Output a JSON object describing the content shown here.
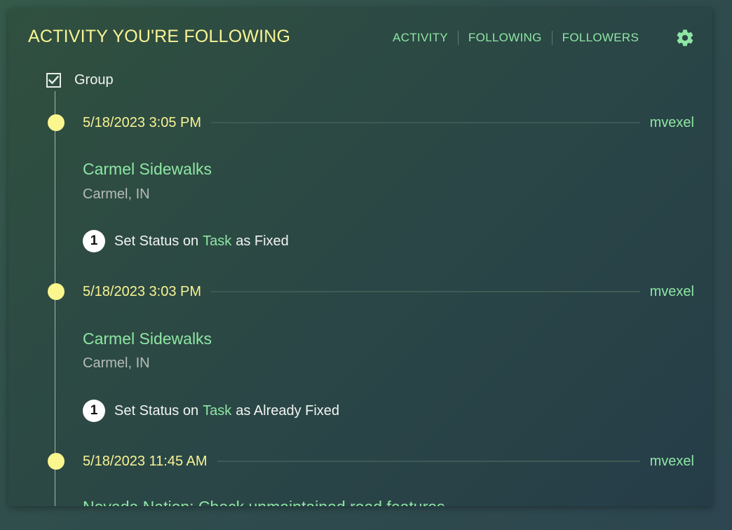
{
  "header": {
    "title": "ACTIVITY YOU'RE FOLLOWING",
    "nav": [
      {
        "label": "ACTIVITY"
      },
      {
        "label": "FOLLOWING"
      },
      {
        "label": "FOLLOWERS"
      }
    ],
    "settings_icon": "gear-icon"
  },
  "group_toggle": {
    "label": "Group",
    "checked": true
  },
  "entries": [
    {
      "timestamp": "5/18/2023 3:05 PM",
      "user": "mvexel",
      "challenge": "Carmel Sidewalks",
      "location": "Carmel, IN",
      "count": "1",
      "action_prefix": "Set Status on",
      "action_link": "Task",
      "action_suffix": "as Fixed"
    },
    {
      "timestamp": "5/18/2023 3:03 PM",
      "user": "mvexel",
      "challenge": "Carmel Sidewalks",
      "location": "Carmel, IN",
      "count": "1",
      "action_prefix": "Set Status on",
      "action_link": "Task",
      "action_suffix": "as Already Fixed"
    },
    {
      "timestamp": "5/18/2023 11:45 AM",
      "user": "mvexel",
      "challenge": "Nevada Nation: Check unmaintained road features"
    }
  ],
  "colors": {
    "accent_yellow": "#f9f494",
    "accent_green": "#8ee6a4",
    "muted_text": "#b5bcb8"
  }
}
